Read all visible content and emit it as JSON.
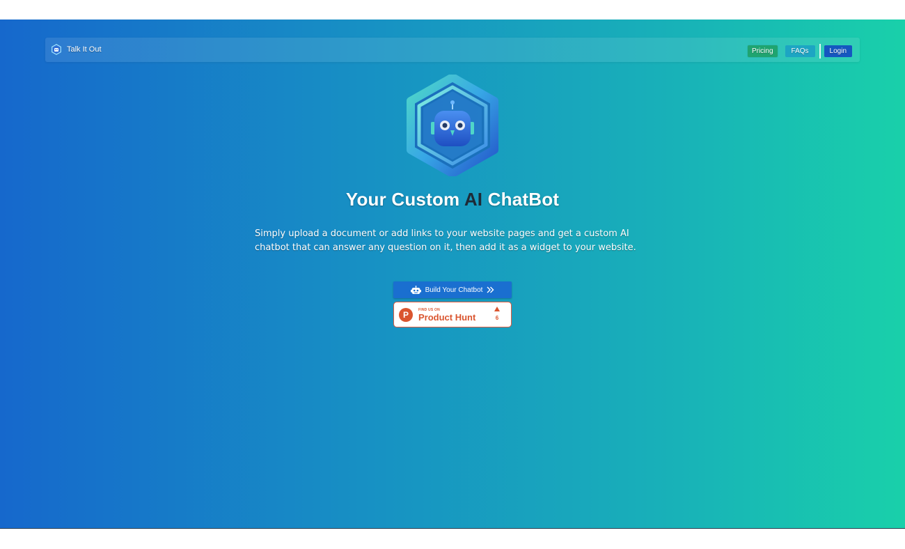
{
  "navbar": {
    "brand_name": "Talk It Out",
    "brand_icon": "hexagon-logo-icon",
    "pricing_label": "Pricing",
    "faqs_label": "FAQs",
    "login_label": "Login"
  },
  "hero": {
    "logo_icon": "robot-hexagon-icon",
    "title_part1": "Your Custom",
    "title_highlight": "AI",
    "title_part2": "ChatBot",
    "description": "Simply upload a document or add links to your website pages and get a custom AI chatbot that can answer any question on it, then add it as a widget to your website.",
    "build_button_label": "Build Your Chatbot",
    "build_button_icon": "robot-icon",
    "build_button_trailing_icon": "double-chevron-right-icon"
  },
  "product_hunt": {
    "find_us_text": "FIND US ON",
    "name": "Product Hunt",
    "logo_letter": "P",
    "upvotes": "6"
  },
  "colors": {
    "gradient_start": "#1668cc",
    "gradient_end": "#19d0aa",
    "pricing_button": "#1fa470",
    "faqs_button": "#1da5c3",
    "login_button": "#1557c0",
    "build_button": "#1a6fd0",
    "product_hunt": "#da552f"
  }
}
